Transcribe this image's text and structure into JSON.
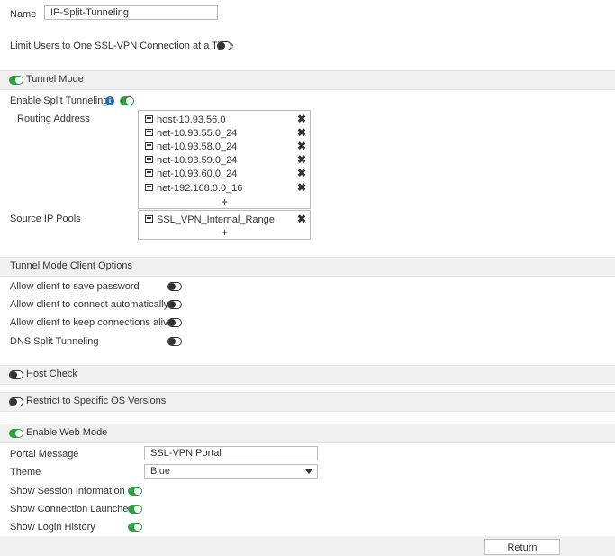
{
  "general": {
    "name_label": "Name",
    "name_value": "IP-Split-Tunneling",
    "limit_users_label": "Limit Users to One SSL-VPN Connection at a Time"
  },
  "tunnel_mode": {
    "title": "Tunnel Mode",
    "enable_split_label": "Enable Split Tunneling",
    "info_glyph": "i",
    "routing_address_label": "Routing Address",
    "routing_addresses": [
      "host-10.93.56.0",
      "net-10.93.55.0_24",
      "net-10.93.58.0_24",
      "net-10.93.59.0_24",
      "net-10.93.60.0_24",
      "net-192.168.0.0_16"
    ],
    "source_ip_pools_label": "Source IP Pools",
    "source_ip_pools": [
      "SSL_VPN_Internal_Range"
    ],
    "remove_glyph": "✖",
    "add_glyph": "+"
  },
  "client_options": {
    "title": "Tunnel Mode Client Options",
    "save_password_label": "Allow client to save password",
    "connect_auto_label": "Allow client to connect automatically",
    "keep_alive_label": "Allow client to keep connections alive",
    "dns_split_label": "DNS Split Tunneling"
  },
  "host_check": {
    "title": "Host Check"
  },
  "os_versions": {
    "title": "Restrict to Specific OS Versions"
  },
  "web_mode": {
    "title": "Enable Web Mode",
    "portal_message_label": "Portal Message",
    "portal_message_value": "SSL-VPN Portal",
    "theme_label": "Theme",
    "theme_value": "Blue",
    "session_info_label": "Show Session Information",
    "connection_launcher_label": "Show Connection Launcher",
    "login_history_label": "Show Login History"
  },
  "footer": {
    "return_label": "Return"
  },
  "colors": {
    "toggle_on": "#2e9e3e",
    "section_bg": "#f0f0f0",
    "info_icon": "#1f6fb2"
  }
}
